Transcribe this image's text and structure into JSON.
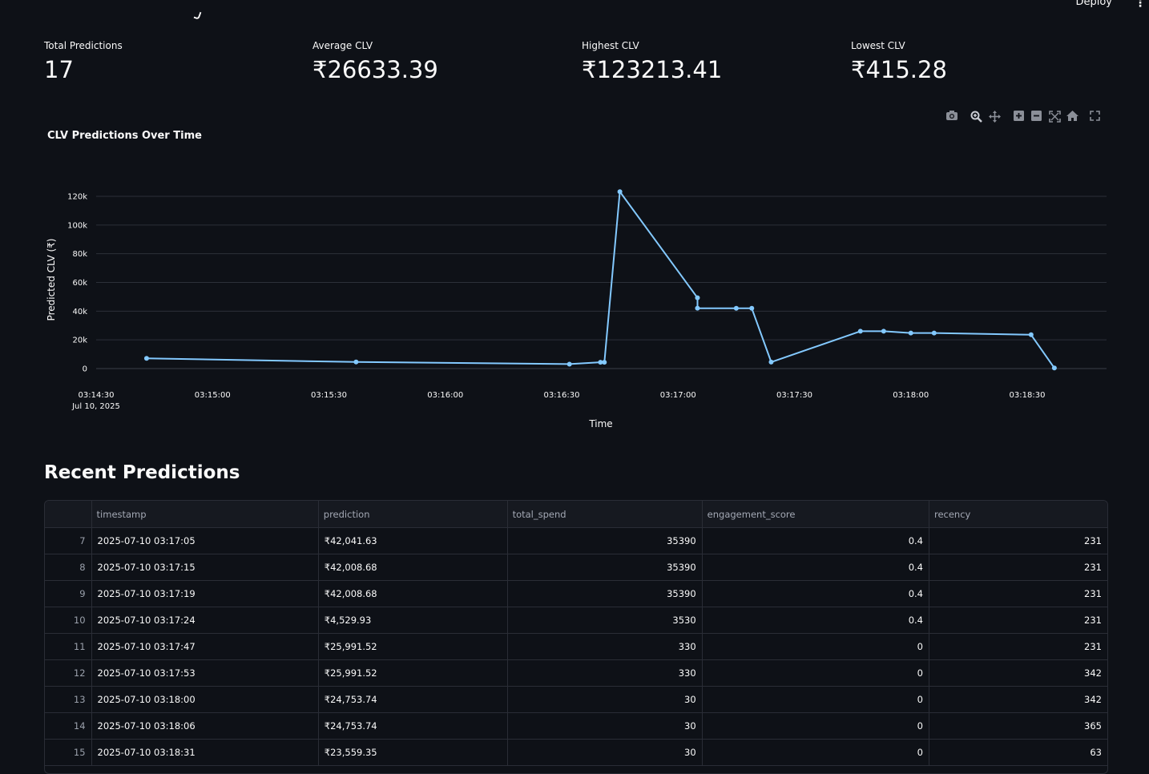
{
  "header": {
    "deploy_label": "Deploy",
    "menu_icon": "kebab-menu-icon"
  },
  "metrics": [
    {
      "label": "Total Predictions",
      "value": "17"
    },
    {
      "label": "Average CLV",
      "value": "₹26633.39"
    },
    {
      "label": "Highest CLV",
      "value": "₹123213.41"
    },
    {
      "label": "Lowest CLV",
      "value": "₹415.28"
    }
  ],
  "modebar": [
    "camera-icon",
    "zoom-icon",
    "pan-icon",
    "zoom-in-icon",
    "zoom-out-icon",
    "autoscale-icon",
    "reset-axes-icon",
    "fullscreen-icon"
  ],
  "chart_data": {
    "type": "line",
    "title": "CLV Predictions Over Time",
    "xlabel": "Time",
    "ylabel": "Predicted CLV (₹)",
    "x_ticks": [
      "03:14:30",
      "03:15:00",
      "03:15:30",
      "03:16:00",
      "03:16:30",
      "03:17:00",
      "03:17:30",
      "03:18:00",
      "03:18:30"
    ],
    "x_date_label": "Jul 10, 2025",
    "y_ticks": [
      "0",
      "20k",
      "40k",
      "60k",
      "80k",
      "100k",
      "120k"
    ],
    "ylim": [
      0,
      120000
    ],
    "grid": true,
    "color": "#83c9ff",
    "points": [
      {
        "t": "03:14:43",
        "y": 7100
      },
      {
        "t": "03:15:37",
        "y": 4600
      },
      {
        "t": "03:16:32",
        "y": 3100
      },
      {
        "t": "03:16:40",
        "y": 4400
      },
      {
        "t": "03:16:41",
        "y": 4400
      },
      {
        "t": "03:16:45",
        "y": 123213.41
      },
      {
        "t": "03:17:05",
        "y": 49300
      },
      {
        "t": "03:17:05",
        "y": 42041.63
      },
      {
        "t": "03:17:15",
        "y": 42008.68
      },
      {
        "t": "03:17:19",
        "y": 42008.68
      },
      {
        "t": "03:17:24",
        "y": 4529.93
      },
      {
        "t": "03:17:47",
        "y": 25991.52
      },
      {
        "t": "03:17:53",
        "y": 25991.52
      },
      {
        "t": "03:18:00",
        "y": 24753.74
      },
      {
        "t": "03:18:06",
        "y": 24753.74
      },
      {
        "t": "03:18:31",
        "y": 23559.35
      },
      {
        "t": "03:18:37",
        "y": 415.28
      }
    ]
  },
  "section": {
    "title": "Recent Predictions"
  },
  "table": {
    "columns": [
      "",
      "timestamp",
      "prediction",
      "total_spend",
      "engagement_score",
      "recency"
    ],
    "rows": [
      [
        "7",
        "2025-07-10 03:17:05",
        "₹42,041.63",
        "35390",
        "0.4",
        "231"
      ],
      [
        "8",
        "2025-07-10 03:17:15",
        "₹42,008.68",
        "35390",
        "0.4",
        "231"
      ],
      [
        "9",
        "2025-07-10 03:17:19",
        "₹42,008.68",
        "35390",
        "0.4",
        "231"
      ],
      [
        "10",
        "2025-07-10 03:17:24",
        "₹4,529.93",
        "3530",
        "0.4",
        "231"
      ],
      [
        "11",
        "2025-07-10 03:17:47",
        "₹25,991.52",
        "330",
        "0",
        "231"
      ],
      [
        "12",
        "2025-07-10 03:17:53",
        "₹25,991.52",
        "330",
        "0",
        "342"
      ],
      [
        "13",
        "2025-07-10 03:18:00",
        "₹24,753.74",
        "30",
        "0",
        "342"
      ],
      [
        "14",
        "2025-07-10 03:18:06",
        "₹24,753.74",
        "30",
        "0",
        "365"
      ],
      [
        "15",
        "2025-07-10 03:18:31",
        "₹23,559.35",
        "30",
        "0",
        "63"
      ]
    ]
  }
}
